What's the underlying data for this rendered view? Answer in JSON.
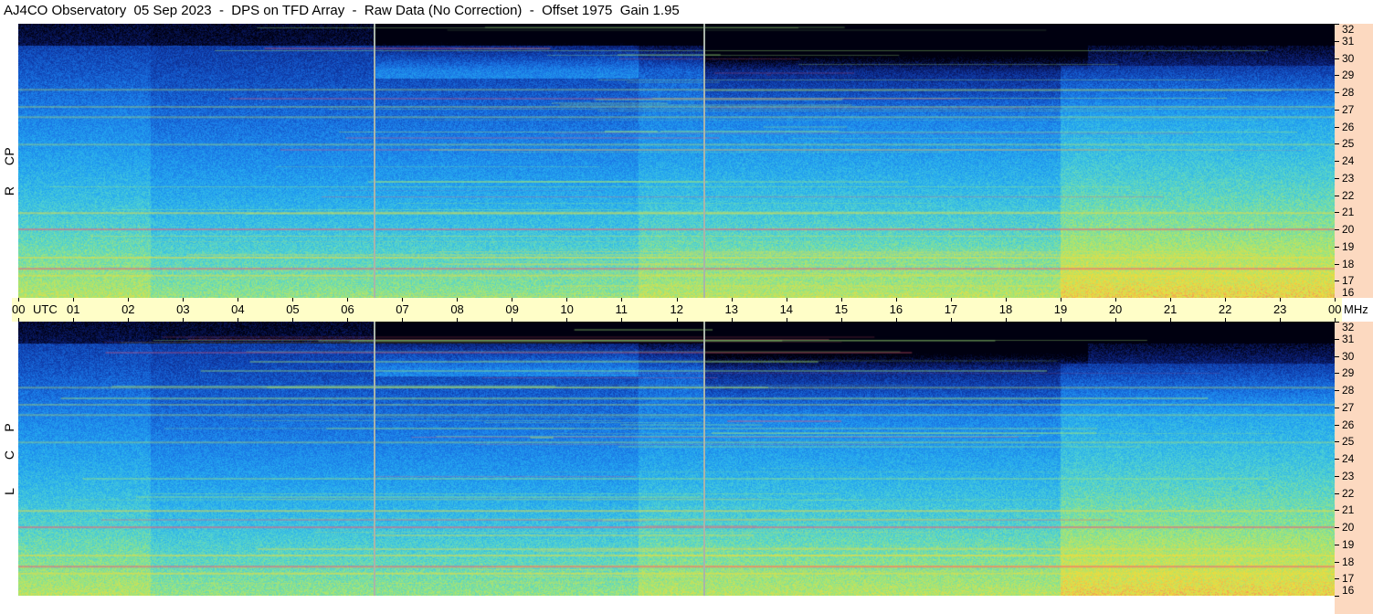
{
  "title": "AJ4CO Observatory  05 Sep 2023  -  DPS on TFD Array  -  Raw Data (No Correction)  -  Offset 1975  Gain 1.95",
  "chart_data": {
    "type": "heatmap",
    "title": "AJ4CO Observatory  05 Sep 2023  -  DPS on TFD Array  -  Raw Data (No Correction)  -  Offset 1975  Gain 1.95",
    "panels": [
      {
        "name": "RCP",
        "letters": [
          "R",
          "C",
          "P"
        ]
      },
      {
        "name": "LCP",
        "letters": [
          "L",
          "C",
          "P"
        ]
      }
    ],
    "x_axis": {
      "unit": "UTC",
      "range_hours": [
        0,
        24
      ],
      "tick_labels": [
        "00",
        "01",
        "02",
        "03",
        "04",
        "05",
        "06",
        "07",
        "08",
        "09",
        "10",
        "11",
        "12",
        "13",
        "14",
        "15",
        "16",
        "17",
        "18",
        "19",
        "20",
        "21",
        "22",
        "23",
        "00"
      ]
    },
    "y_axis": {
      "unit": "MHz",
      "range": [
        16,
        32
      ],
      "tick_labels": [
        "32",
        "31",
        "30",
        "29",
        "28",
        "27",
        "26",
        "25",
        "24",
        "23",
        "22",
        "21",
        "20",
        "19",
        "18",
        "17",
        "16"
      ]
    },
    "markers_utc_hours": [
      6.5,
      12.5
    ],
    "colormap": [
      "#000010",
      "#0a1c6e",
      "#1043b4",
      "#1a78e6",
      "#25aaf0",
      "#50d2d2",
      "#a0e678",
      "#f0dc3c",
      "#f05a78",
      "#ffffff"
    ]
  }
}
